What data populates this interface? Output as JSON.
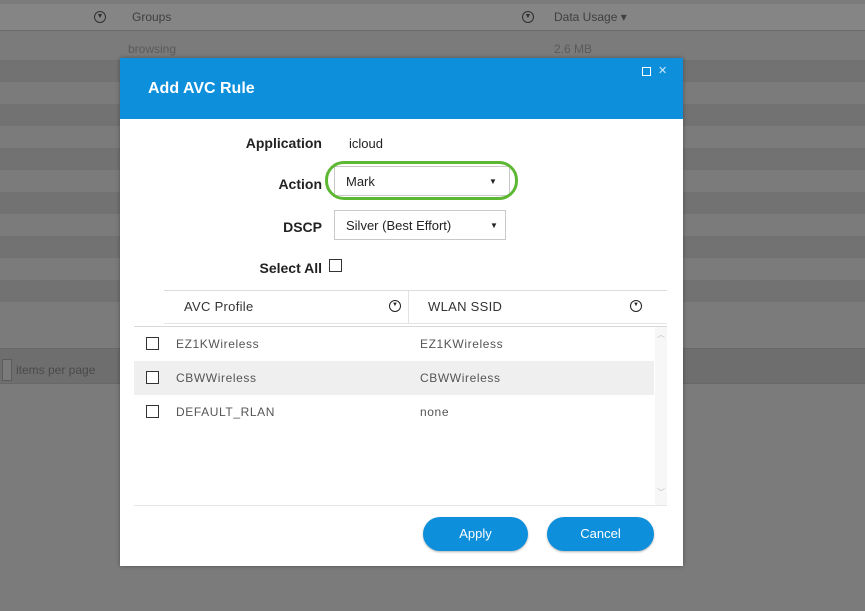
{
  "background": {
    "columns": {
      "groups": "Groups",
      "data_usage": "Data Usage ▾"
    },
    "first_row": {
      "group": "browsing",
      "usage": "2.6 MB"
    },
    "pager_text": "items per page"
  },
  "dialog": {
    "title": "Add AVC Rule",
    "application_label": "Application",
    "application_value": "icloud",
    "action_label": "Action",
    "action_value": "Mark",
    "dscp_label": "DSCP",
    "dscp_value": "Silver (Best Effort)",
    "select_all_label": "Select All",
    "table": {
      "headers": {
        "profile": "AVC Profile",
        "ssid": "WLAN SSID"
      },
      "rows": [
        {
          "profile": "EZ1KWireless",
          "ssid": "EZ1KWireless"
        },
        {
          "profile": "CBWWireless",
          "ssid": "CBWWireless"
        },
        {
          "profile": "DEFAULT_RLAN",
          "ssid": "none"
        }
      ]
    },
    "apply_label": "Apply",
    "cancel_label": "Cancel"
  },
  "colors": {
    "accent": "#0d8fdc",
    "highlight": "#5cb832"
  },
  "icons": [
    "filter-icon",
    "caret-down-icon",
    "maximize-icon",
    "close-icon"
  ]
}
